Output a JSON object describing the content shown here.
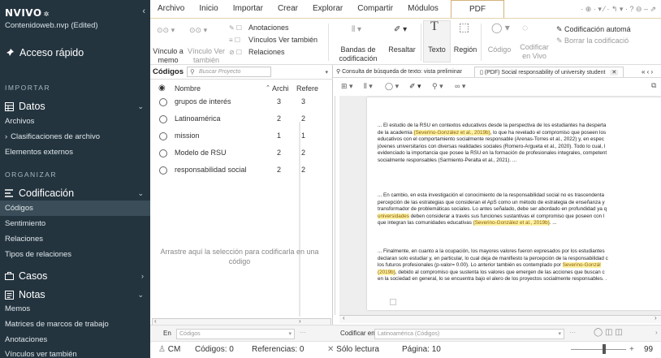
{
  "sidebar": {
    "logo": "NVIVO",
    "collapse": "‹",
    "project": "Contenidoweb.nvp (Edited)",
    "quick_access": "Acceso rápido",
    "sections": [
      "IMPORTAR",
      "ORGANIZAR"
    ],
    "datos": {
      "label": "Datos",
      "items": [
        "Archivos",
        "Clasificaciones de archivo",
        "Elementos externos"
      ]
    },
    "codificacion": {
      "label": "Codificación",
      "items": [
        "Códigos",
        "Sentimiento",
        "Relaciones",
        "Tipos de relaciones"
      ]
    },
    "casos": {
      "label": "Casos"
    },
    "notas": {
      "label": "Notas",
      "items": [
        "Memos",
        "Matrices de marcos de trabajo",
        "Anotaciones",
        "Vínculos ver también"
      ]
    }
  },
  "ribbon": {
    "tabs": [
      "Archivo",
      "Inicio",
      "Importar",
      "Crear",
      "Explorar",
      "Compartir",
      "Módulos",
      "PDF"
    ],
    "buttons": {
      "vinculo_memo": "Vínculo a\nmemo",
      "vinculo_ver": "Vínculo Ver\ntambién",
      "anotaciones": "Anotaciones",
      "vinculos_ver": "Vínculos Ver también",
      "relaciones": "Relaciones",
      "bandas": "Bandas de\ncodificación",
      "resaltar": "Resaltar",
      "texto": "Texto",
      "region": "Región",
      "codigo": "Código",
      "codificar_vivo": "Codificar\nen Vivo",
      "codif_auto": "Codificación automá",
      "borrar": "Borrar la codificació"
    }
  },
  "codes": {
    "title": "Códigos",
    "search_placeholder": "Buscar Proyecto",
    "columns": [
      "Nombre",
      "Archi",
      "Refere"
    ],
    "rows": [
      {
        "name": "grupos de interés",
        "files": "3",
        "refs": "3"
      },
      {
        "name": "Latinoamérica",
        "files": "2",
        "refs": "2"
      },
      {
        "name": "mission",
        "files": "1",
        "refs": "1"
      },
      {
        "name": "Modelo de RSU",
        "files": "2",
        "refs": "2"
      },
      {
        "name": "responsabilidad social",
        "files": "2",
        "refs": "2"
      }
    ],
    "dropzone": "Arrastre aquí la selección para codificarla en una código"
  },
  "doc": {
    "tab1": "Consulta de búsqueda de texto: vista preliminar",
    "tab2": "(PDF) Social responsability of university student",
    "paragraphs": [
      {
        "lines": [
          [
            {
              "t": "... El estudio de la RSU en contextos educativos desde la perspectiva de los estudiantes ha desperta"
            }
          ],
          [
            {
              "t": "de la academia "
            },
            {
              "t": "(Severino-González et al., 2019b)",
              "h": true
            },
            {
              "t": ", lo que ha revelado el compromiso que poseen los"
            }
          ],
          [
            {
              "t": "educativos con el comportamiento socialmente responsable (Arenas-Torres et al., 2022) y, en espec"
            }
          ],
          [
            {
              "t": "jóvenes universitarios con diversas realidades sociales (Romero-Argueta et al., 2020). Todo lo cual, l"
            }
          ],
          [
            {
              "t": "evidenciado la importancia que posee la RSU en la formación de profesionales integrales, competent"
            }
          ],
          [
            {
              "t": "socialmente responsables (Sarmiento-Peralta et al., 2021). ..."
            }
          ]
        ]
      },
      {
        "lines": [
          [
            {
              "t": "... En cambio, en esta investigación el conocimiento de la responsabilidad social no es trascendenta"
            }
          ],
          [
            {
              "t": "percepción de las estrategias que consideran el ApS como un método de estrategia de enseñanza y"
            }
          ],
          [
            {
              "t": "transformador de problemáticas sociales. Lo antes señalado, debe ser abordado en profundidad ya q"
            }
          ],
          [
            {
              "t": "universidades",
              "h": true
            },
            {
              "t": " deben considerar a través sus funciones sustantivas el compromiso que poseen con l"
            }
          ],
          [
            {
              "t": "que integran las comunidades educativas "
            },
            {
              "t": "(Severino-González et al., 2019b)",
              "h": true
            },
            {
              "t": ". ..."
            }
          ]
        ]
      },
      {
        "lines": [
          [
            {
              "t": "... Finalmente, en cuanto a la ocupación, los mayores valores fueron expresados por los estudiantes"
            }
          ],
          [
            {
              "t": "declaran solo estudiar y, en particular, lo cual deja de manifiesto la percepción de la responsabilidad c"
            }
          ],
          [
            {
              "t": "los futuros profesionales (p-valor= 0.00). Lo anterior también es contemplado por "
            },
            {
              "t": "Severino-Gonzál",
              "h": true
            }
          ],
          [
            {
              "t": "(2019b)",
              "h": true
            },
            {
              "t": ", debido al compromiso que sustenta los valores que emergen de las acciones que buscan c"
            }
          ],
          [
            {
              "t": "en la sociedad en general, lo se encuentra bajo el alero de los proyectos socialmente responsables. ."
            }
          ]
        ]
      }
    ]
  },
  "bottom": {
    "en_label": "En",
    "en_value": "Códigos",
    "codificar_label": "Codificar en",
    "codificar_value": "Latinoamérica (Códigos)"
  },
  "status": {
    "user": "CM",
    "codigos": "Códigos: 0",
    "referencias": "Referencias: 0",
    "lectura": "Sólo lectura",
    "pagina": "Página: 10",
    "zoom": "99"
  }
}
